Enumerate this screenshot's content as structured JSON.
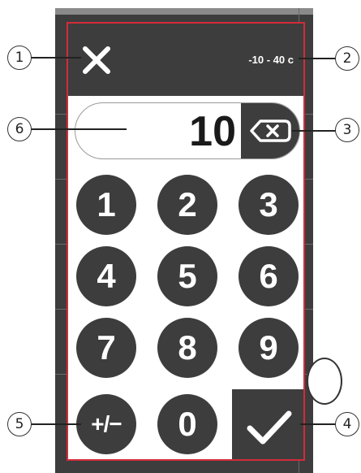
{
  "keypad": {
    "range_label": "-10 - 40 c",
    "display_value": "10",
    "keys": [
      "1",
      "2",
      "3",
      "4",
      "5",
      "6",
      "7",
      "8",
      "9",
      "+/−",
      "0"
    ]
  },
  "callouts": [
    "1",
    "2",
    "3",
    "4",
    "5",
    "6"
  ],
  "colors": {
    "frame_highlight": "#d52b3a",
    "key_fill": "#3d3d3d",
    "key_text": "#ffffff"
  },
  "icons": {
    "close": "close-icon",
    "backspace": "backspace-icon",
    "confirm": "checkmark-icon"
  }
}
